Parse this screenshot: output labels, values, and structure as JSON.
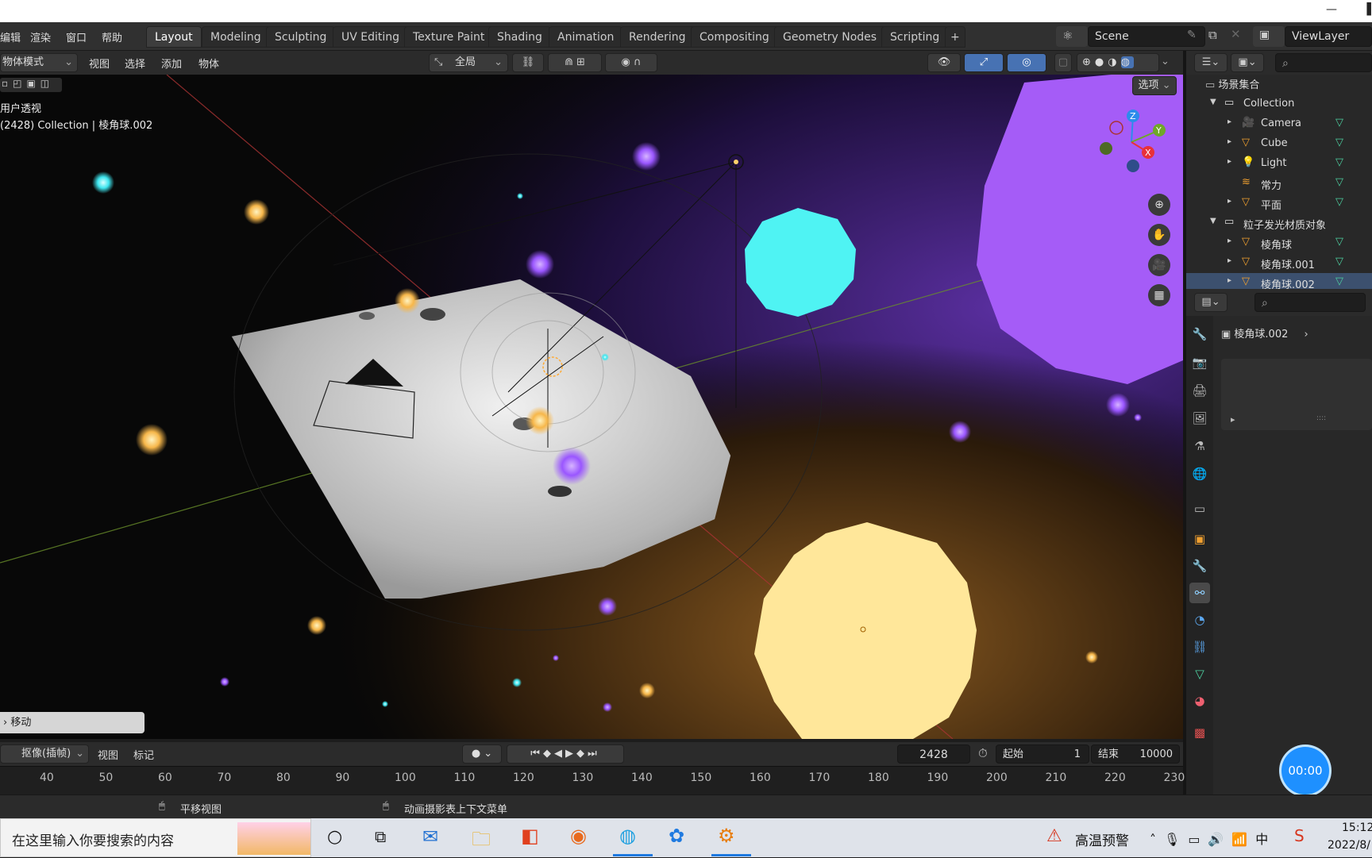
{
  "window": {
    "minimize": "—",
    "maximize": "▐"
  },
  "menu": [
    "编辑",
    "渲染",
    "窗口",
    "帮助"
  ],
  "tabs": [
    "Layout",
    "Modeling",
    "Sculpting",
    "UV Editing",
    "Texture Paint",
    "Shading",
    "Animation",
    "Rendering",
    "Compositing",
    "Geometry Nodes",
    "Scripting",
    "+"
  ],
  "scene": {
    "name": "Scene",
    "view_layer": "ViewLayer"
  },
  "viewport_header": {
    "mode": "物体模式",
    "menus": [
      "视图",
      "选择",
      "添加",
      "物体"
    ],
    "transform": "全局"
  },
  "viewport": {
    "view_name": "用户透视",
    "view_info": "(2428) Collection | 棱角球.002",
    "options": "选项",
    "axis": {
      "x": "X",
      "y": "Y",
      "z": "Z"
    },
    "last_op": "移动"
  },
  "outliner": {
    "root": "场景集合",
    "items": [
      {
        "name": "Collection",
        "level": 1,
        "expand": "▼"
      },
      {
        "name": "Camera",
        "level": 2,
        "expand": "▸"
      },
      {
        "name": "Cube",
        "level": 2,
        "expand": "▸"
      },
      {
        "name": "Light",
        "level": 2,
        "expand": "▸"
      },
      {
        "name": "常力",
        "level": 2,
        "expand": ""
      },
      {
        "name": "平面",
        "level": 2,
        "expand": "▸"
      },
      {
        "name": "粒子发光材质对象",
        "level": 1,
        "expand": "▼"
      },
      {
        "name": "棱角球",
        "level": 2,
        "expand": "▸"
      },
      {
        "name": "棱角球.001",
        "level": 2,
        "expand": "▸"
      },
      {
        "name": "棱角球.002",
        "level": 2,
        "expand": "▸"
      }
    ]
  },
  "properties": {
    "object": "棱角球.002",
    "arrow": "›",
    "expander": "▸",
    "dots": "::::"
  },
  "timeline": {
    "mode": "抠像(插帧)",
    "menus": [
      "视图",
      "标记"
    ],
    "current_frame": "2428",
    "start_label": "起始",
    "start": "1",
    "end_label": "结束",
    "end": "10000",
    "ruler": [
      "40",
      "50",
      "60",
      "70",
      "80",
      "90",
      "100",
      "110",
      "120",
      "130",
      "140",
      "150",
      "160",
      "170",
      "180",
      "190",
      "200",
      "210",
      "220",
      "230"
    ]
  },
  "status": {
    "left": "平移视图",
    "right": "动画摄影表上下文菜单"
  },
  "timer": "00:00",
  "taskbar": {
    "search": "在这里输入你要搜索的内容",
    "alert": "高温预警",
    "time": "15:12",
    "date": "2022/8/"
  }
}
